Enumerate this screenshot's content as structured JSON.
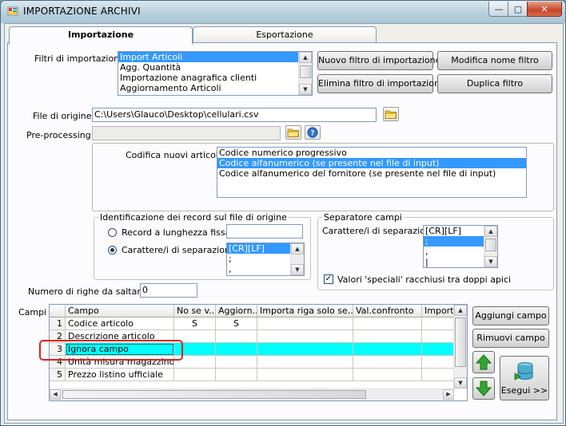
{
  "window": {
    "title": "IMPORTAZIONE ARCHIVI",
    "controls": {
      "minimize": "—",
      "maximize": "▢",
      "close": "✕"
    }
  },
  "tabs": [
    {
      "label": "Importazione",
      "active": true
    },
    {
      "label": "Esportazione",
      "active": false
    }
  ],
  "filters": {
    "label": "Filtri di importazione :",
    "items": [
      "Import Articoli",
      "Agg. Quantità",
      "Importazione anagrafica clienti",
      "Aggiornamento Articoli"
    ],
    "selected": 0
  },
  "filter_buttons": {
    "new": "Nuovo filtro di importazione",
    "rename": "Modifica nome filtro",
    "delete": "Elimina filtro di importazione",
    "duplicate": "Duplica filtro"
  },
  "source_file": {
    "label": "File di origine :",
    "value": "C:\\Users\\Glauco\\Desktop\\cellulari.csv"
  },
  "preprocessing": {
    "label": "Pre-processing :",
    "value": ""
  },
  "article_coding": {
    "label": "Codifica nuovi articoli :",
    "items": [
      "Codice numerico progressivo",
      "Codice alfanumerico (se presente nel file di input)",
      "Codice alfanumerico del fornitore (se presente nel file di input)"
    ],
    "selected": 1
  },
  "record_id": {
    "legend": "Identificazione dei record sul file di origine",
    "fixed_length_label": "Record a lunghezza fissa",
    "separator_label": "Carattere/i di separazione",
    "fixed_length_value": "",
    "separator_items": [
      "[CR][LF]",
      ";",
      ","
    ],
    "selected_option": "separator"
  },
  "field_separator": {
    "legend": "Separatore campi",
    "label": "Carattere/i di separazione",
    "items": [
      "[CR][LF]",
      ";",
      ",",
      "|"
    ],
    "selected": 1,
    "quoted_label": "Valori 'speciali' racchiusi tra doppi apici",
    "quoted_checked": true,
    "check_mark": "✓"
  },
  "skip_rows": {
    "label": "Numero di righe da saltare :",
    "value": "0"
  },
  "fields": {
    "label": "Campi :",
    "columns": [
      "Campo",
      "No se v...",
      "Aggiorn...",
      "Importa riga solo se...",
      "Val.confronto",
      "Importa"
    ],
    "rows": [
      {
        "num": "1",
        "campo": "Codice articolo",
        "nosev": "S",
        "aggiorn": "S"
      },
      {
        "num": "2",
        "campo": "Descrizione articolo",
        "nosev": "",
        "aggiorn": ""
      },
      {
        "num": "3",
        "campo": "Ignora campo",
        "nosev": "",
        "aggiorn": ""
      },
      {
        "num": "4",
        "campo": "Unità misura magazzino",
        "nosev": "",
        "aggiorn": ""
      },
      {
        "num": "5",
        "campo": "Prezzo listino ufficiale",
        "nosev": "",
        "aggiorn": ""
      }
    ],
    "selected_row": 2
  },
  "field_buttons": {
    "add": "Aggiungi campo",
    "remove": "Rimuovi campo",
    "run": "Esegui >>"
  },
  "colors": {
    "selection": "#3399ff",
    "row_highlight": "#00ffff",
    "annotation": "#e02020",
    "arrow_green": "#2fa82f"
  }
}
